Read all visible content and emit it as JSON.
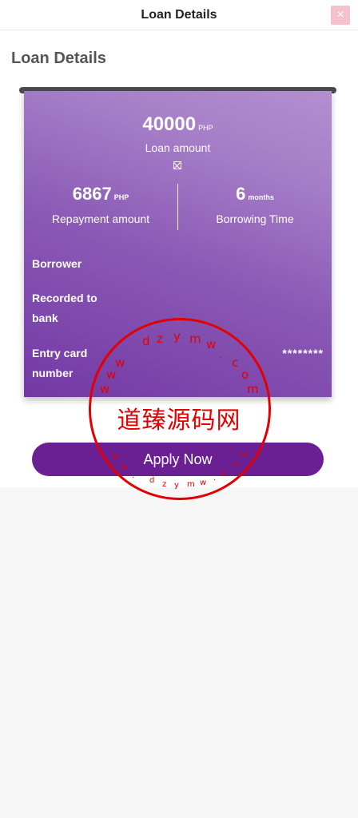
{
  "header": {
    "title": "Loan Details",
    "close_label": "×"
  },
  "page": {
    "title": "Loan Details"
  },
  "card": {
    "loan_amount": "40000",
    "loan_amount_unit": "PHP",
    "loan_amount_label": "Loan amount",
    "repayment_amount": "6867",
    "repayment_unit": "PHP",
    "repayment_label": "Repayment amount",
    "borrowing_time": "6",
    "borrowing_time_unit": "months",
    "borrowing_time_label": "Borrowing Time",
    "rows": [
      {
        "label": "Borrower",
        "value": ""
      },
      {
        "label": "Recorded to bank",
        "value": ""
      },
      {
        "label": "Entry card number",
        "value": "********"
      }
    ]
  },
  "actions": {
    "apply_label": "Apply Now"
  },
  "stamp": {
    "text": "道臻源码网",
    "ring_chars": [
      "d",
      "z",
      "y",
      "m",
      "w",
      ".",
      "c",
      "o",
      "m",
      "w",
      "w",
      "w"
    ],
    "bottom_chars": [
      "w",
      "w",
      ".",
      "d",
      "z",
      "y",
      "m",
      "w",
      ".",
      "c",
      "o",
      "m"
    ]
  },
  "colors": {
    "accent": "#6a1f92",
    "stamp": "#e20000"
  }
}
